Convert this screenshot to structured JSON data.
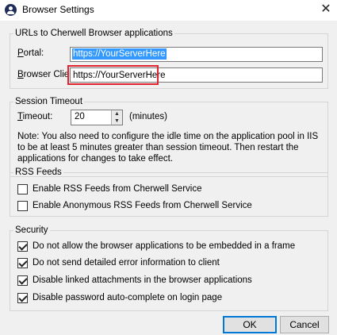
{
  "window": {
    "title": "Browser Settings",
    "close_glyph": "✕",
    "app_icon": "user-icon"
  },
  "urls_group": {
    "legend": "URLs to Cherwell Browser applications",
    "portal_label": "Portal:",
    "portal_value": "https://YourServerHere",
    "browser_client_label": "Browser Client:",
    "browser_client_value": "https://YourServerHere"
  },
  "session_group": {
    "legend": "Session Timeout",
    "timeout_label": "Timeout:",
    "timeout_value": "20",
    "timeout_unit": "(minutes)",
    "note": "Note: You also need to configure the idle time on the application pool in IIS to be at least 5 minutes greater than session timeout. Then restart the applications for changes to take effect."
  },
  "rss_group": {
    "legend": "RSS Feeds",
    "items": [
      {
        "label": "Enable RSS Feeds from Cherwell Service",
        "checked": false
      },
      {
        "label": "Enable Anonymous RSS Feeds from Cherwell Service",
        "checked": false
      }
    ]
  },
  "security_group": {
    "legend": "Security",
    "items": [
      {
        "label": "Do not allow the browser applications to be embedded in a frame",
        "checked": true
      },
      {
        "label": "Do not send detailed error information to client",
        "checked": true
      },
      {
        "label": "Disable linked attachments in the browser applications",
        "checked": true
      },
      {
        "label": "Disable password auto-complete on login page",
        "checked": true
      }
    ]
  },
  "buttons": {
    "ok": "OK",
    "cancel": "Cancel"
  },
  "colors": {
    "highlight": "#e0242f",
    "selection": "#3399ff",
    "default_button_border": "#0078d7"
  }
}
